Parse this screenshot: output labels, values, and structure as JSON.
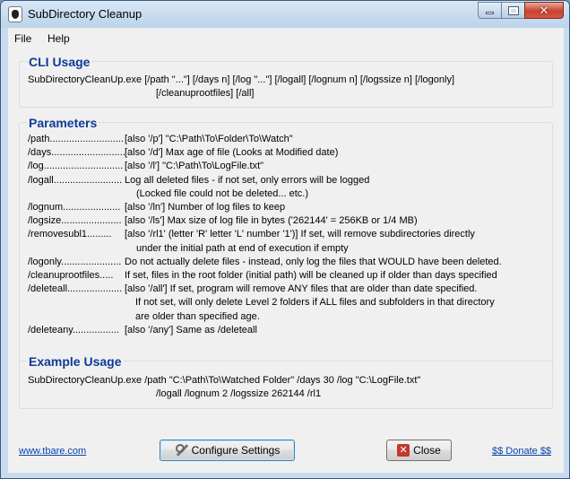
{
  "window": {
    "title": "SubDirectory Cleanup",
    "icon": "app-icon"
  },
  "menu": {
    "file": "File",
    "help": "Help"
  },
  "cli": {
    "heading": "CLI Usage",
    "line1": "SubDirectoryCleanUp.exe [/path \"...\"] [/days n] [/log \"...\"] [/logall] [/lognum n] [/logssize n] [/logonly]",
    "line2": "[/cleanuprootfiles] [/all]"
  },
  "parameters": {
    "heading": "Parameters",
    "rows": [
      {
        "key": "/path...........................",
        "val": "[also '/p'] \"C:\\Path\\To\\Folder\\To\\Watch\""
      },
      {
        "key": "/days...........................",
        "val": "[also '/d'] Max age of file (Looks at Modified date)"
      },
      {
        "key": "/log.............................",
        "val": "[also '/l'] \"C:\\Path\\To\\LogFile.txt\""
      },
      {
        "key": "/logall.........................",
        "val": "Log all deleted files - if not set, only errors will be logged",
        "cont": [
          "(Locked file could not be deleted... etc.)"
        ]
      },
      {
        "key": "/lognum.....................",
        "val": "[also '/ln'] Number of log files to keep"
      },
      {
        "key": "/logsize......................",
        "val": "[also '/ls'] Max size of log file in bytes ('262144' = 256KB or 1/4 MB)"
      },
      {
        "key": "/removesubl1.........",
        "val": "[also '/rl1' (letter 'R' letter 'L' number '1')] If set, will remove subdirectories directly",
        "cont": [
          "under the initial path at end of execution if empty"
        ]
      },
      {
        "key": "/logonly......................",
        "val": "Do not actually delete files - instead, only log the files that WOULD have been deleted."
      },
      {
        "key": "/cleanuprootfiles.....",
        "val": "If set, files in the root folder (initial path) will be cleaned up if older than days specified"
      },
      {
        "key": "/deleteall....................",
        "val": "[also '/all'] If set, program will remove ANY files that are older than date specified.",
        "cont": [
          "If not set, will only delete Level 2 folders if ALL files and subfolders in that directory",
          "are older than specified age."
        ]
      },
      {
        "key": "/deleteany.................",
        "val": "[also '/any'] Same as /deleteall"
      }
    ]
  },
  "example": {
    "heading": "Example Usage",
    "line1": "SubDirectoryCleanUp.exe /path \"C:\\Path\\To\\Watched Folder\" /days 30 /log \"C:\\LogFile.txt\"",
    "line2": "/logall /lognum 2 /logssize 262144 /rl1"
  },
  "footer": {
    "website": "www.tbare.com",
    "configure_label": "Configure Settings",
    "close_label": "Close",
    "donate": "$$ Donate $$"
  },
  "colors": {
    "heading": "#0f3a97",
    "link": "#0645ad"
  }
}
